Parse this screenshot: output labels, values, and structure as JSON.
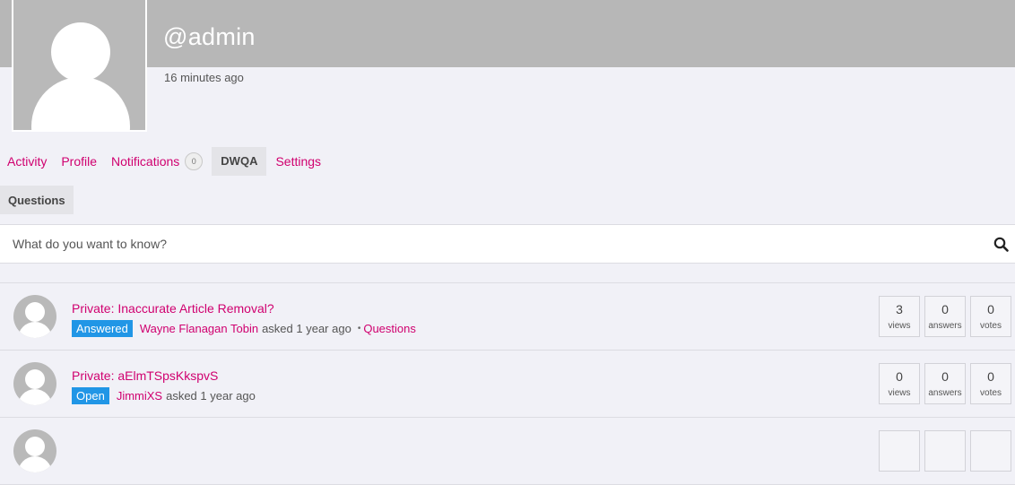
{
  "profile": {
    "username": "@admin",
    "last_active": "16 minutes ago"
  },
  "nav": {
    "items": [
      {
        "label": "Activity"
      },
      {
        "label": "Profile"
      },
      {
        "label": "Notifications",
        "count": "0"
      },
      {
        "label": "DWQA",
        "current": true
      },
      {
        "label": "Settings"
      }
    ],
    "subnav_label": "Questions"
  },
  "search": {
    "placeholder": "What do you want to know?",
    "icon": "search-icon"
  },
  "questions": [
    {
      "title": "Private: Inaccurate Article Removal?",
      "status": "Answered",
      "author": "Wayne Flanagan Tobin",
      "asked_text": "asked 1 year ago",
      "category": "Questions",
      "views": "3",
      "answers": "0",
      "votes": "0"
    },
    {
      "title": "Private: aElmTSpsKkspvS",
      "status": "Open",
      "author": "JimmiXS",
      "asked_text": "asked 1 year ago",
      "category": "",
      "views": "0",
      "answers": "0",
      "votes": "0"
    }
  ],
  "stat_labels": {
    "views": "views",
    "answers": "answers",
    "votes": "votes"
  },
  "colors": {
    "accent": "#d0006f",
    "status_badge": "#2196e6",
    "cover": "#b7b7b7",
    "background": "#f1f1f7"
  }
}
